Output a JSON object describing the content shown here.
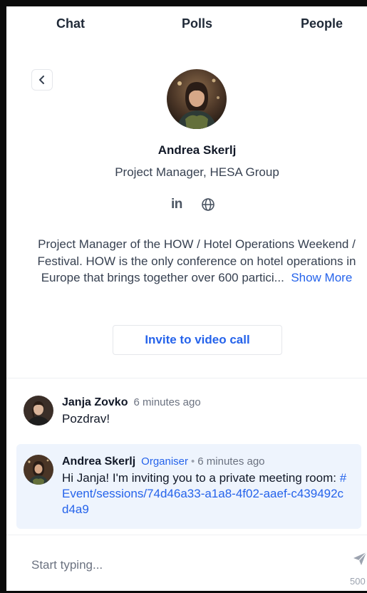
{
  "tabs": [
    {
      "label": "Chat"
    },
    {
      "label": "Polls"
    },
    {
      "label": "People"
    }
  ],
  "profile": {
    "name": "Andrea Skerlj",
    "role": "Project Manager, HESA Group",
    "socials": {
      "linkedin_label": "in",
      "linkedin_icon": "linkedin-icon",
      "website_icon": "globe-icon"
    },
    "bio": "Project Manager of the HOW / Hotel Operations Weekend / Festival. HOW is the only conference on hotel operations in Europe that brings together over 600 partici...",
    "show_more": "Show More",
    "invite_label": "Invite to video call"
  },
  "messages": [
    {
      "sender": "Janja Zovko",
      "time": "6 minutes ago",
      "text": "Pozdrav!"
    },
    {
      "sender": "Andrea Skerlj",
      "badge": "Organiser",
      "separator": "•",
      "time": "6 minutes ago",
      "text": "Hi Janja! I'm inviting you to a private meeting room: ",
      "link": "#Event/sessions/74d46a33-a1a8-4f02-aaef-c439492cd4a9"
    }
  ],
  "composer": {
    "placeholder": "Start typing...",
    "counter": "500",
    "send_icon": "send-icon"
  },
  "colors": {
    "accent": "#2563eb",
    "highlight_bg": "#eef4fd",
    "text": "#1f2937"
  }
}
